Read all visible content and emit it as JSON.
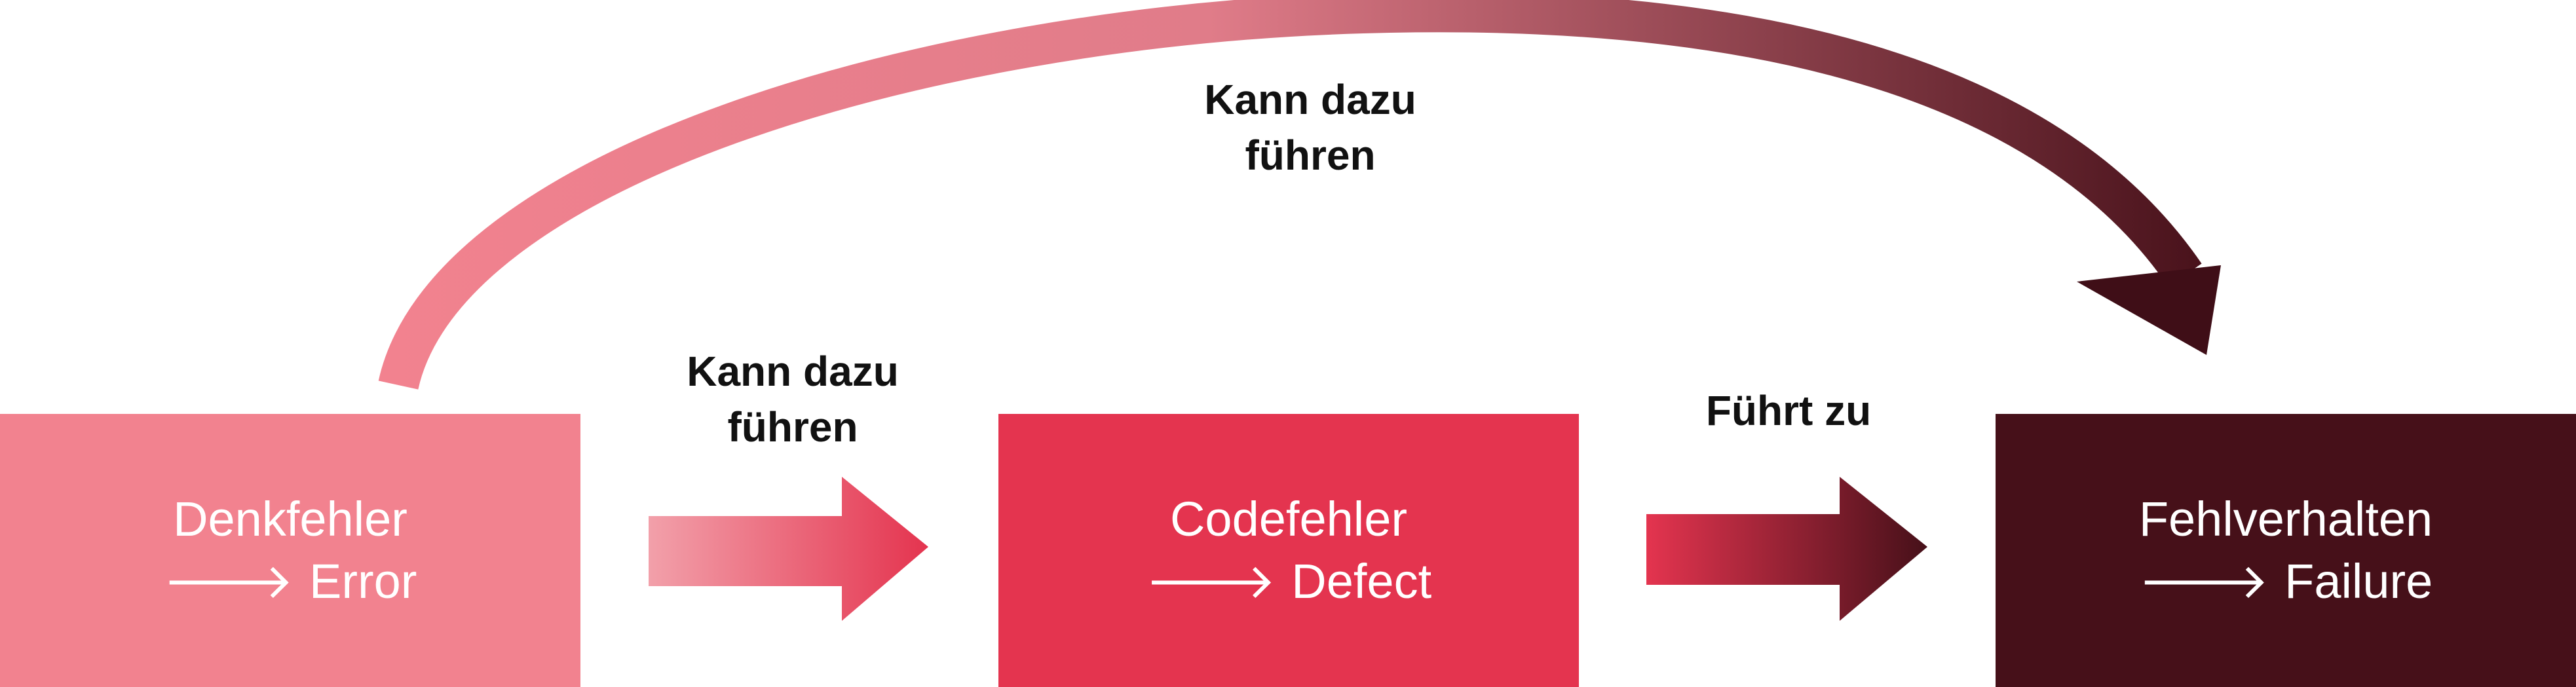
{
  "nodes": {
    "error": {
      "line1": "Denkfehler",
      "line2": "Error",
      "color": "#f2828f"
    },
    "defect": {
      "line1": "Codefehler",
      "line2": "Defect",
      "color": "#e4344f"
    },
    "failure": {
      "line1": "Fehlverhalten",
      "line2": "Failure",
      "color": "#461019"
    }
  },
  "arrow_glyph": "🡒",
  "edges": {
    "error_to_defect": {
      "line1": "Kann dazu",
      "line2": "führen"
    },
    "defect_to_failure": {
      "line1": "Führt zu"
    },
    "error_to_failure": {
      "line1": "Kann dazu",
      "line2": "führen"
    }
  },
  "colors": {
    "light": "#f2828f",
    "mid": "#e4344f",
    "dark": "#461019"
  }
}
